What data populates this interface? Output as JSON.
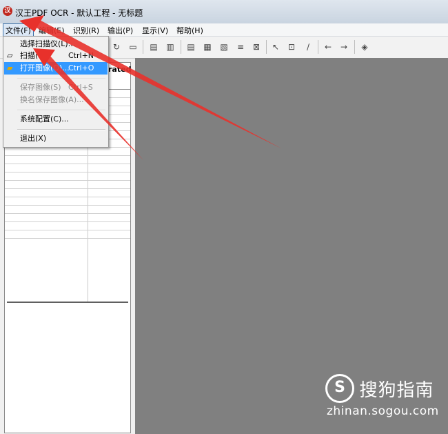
{
  "window": {
    "title": "汉王PDF OCR - 默认工程 - 无标题",
    "app_icon_glyph": "汉"
  },
  "menubar": [
    {
      "label": "文件(F)"
    },
    {
      "label": "编辑(E)"
    },
    {
      "label": "识别(R)"
    },
    {
      "label": "输出(P)"
    },
    {
      "label": "显示(V)"
    },
    {
      "label": "帮助(H)"
    }
  ],
  "file_menu": {
    "items": [
      {
        "label": "选择扫描仪(L)...",
        "shortcut": ""
      },
      {
        "label": "扫描(N)",
        "shortcut": "Ctrl+N"
      },
      {
        "label": "打开图像(O)...",
        "shortcut": "Ctrl+O"
      },
      {
        "label": "保存图像(S)",
        "shortcut": "Ctrl+S"
      },
      {
        "label": "换名保存图像(A)...",
        "shortcut": ""
      },
      {
        "label": "系统配置(C)...",
        "shortcut": ""
      },
      {
        "label": "退出(X)",
        "shortcut": ""
      }
    ]
  },
  "left_panel": {
    "header_label": "rated"
  },
  "watermark": {
    "logo_glyph": "S",
    "brand": "搜狗指南",
    "url": "zhinan.sogou.com"
  },
  "colors": {
    "workarea": "#808080",
    "menu_highlight": "#3399ff",
    "arrow": "#e8312b"
  }
}
